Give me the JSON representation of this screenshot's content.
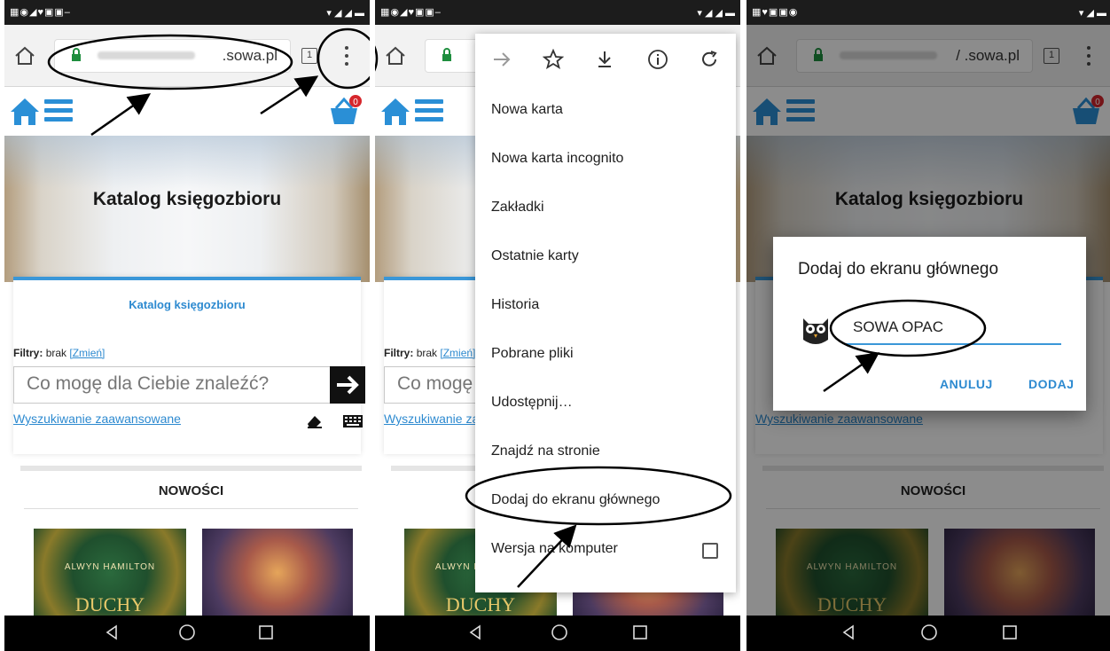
{
  "colors": {
    "accent": "#2d8ad0",
    "dark": "#111111"
  },
  "browser": {
    "domain": ".sowa.pl",
    "domain_with_path": "/ .sowa.pl",
    "tab_count": "1"
  },
  "site": {
    "hero_title": "Katalog księgozbioru",
    "search_card_title": "Katalog księgozbioru",
    "filters_label": "Filtry:",
    "filters_value": "brak",
    "filters_link": "[Zmień]",
    "search_placeholder": "Co mogę dla Ciebie znaleźć?",
    "advanced_link": "Wyszukiwanie zaawansowane",
    "section_title": "NOWOŚCI",
    "basket_count": "0",
    "book1_author": "ALWYN HAMILTON",
    "book1_title": "DUCHY"
  },
  "menu": {
    "items": [
      "Nowa karta",
      "Nowa karta incognito",
      "Zakładki",
      "Ostatnie karty",
      "Historia",
      "Pobrane pliki",
      "Udostępnij…",
      "Znajdź na stronie",
      "Dodaj do ekranu głównego",
      "Wersja na komputer"
    ],
    "icons": [
      "forward-icon",
      "star-icon",
      "download-icon",
      "info-icon",
      "reload-icon"
    ]
  },
  "dialog": {
    "title": "Dodaj do ekranu głównego",
    "name_value": "SOWA OPAC",
    "cancel": "ANULUJ",
    "add": "DODAJ"
  }
}
